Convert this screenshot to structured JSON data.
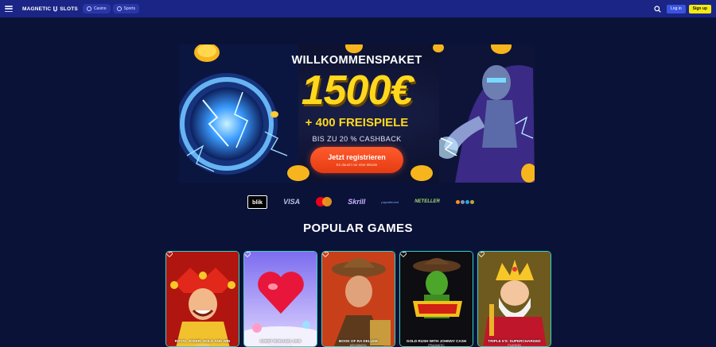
{
  "header": {
    "logo_left": "MAGNETIC",
    "logo_right": "SLOTS",
    "nav": [
      {
        "label": "Casino",
        "icon": "casino-icon"
      },
      {
        "label": "Sports",
        "icon": "sports-icon"
      }
    ],
    "login_label": "Log in",
    "signup_label": "Sign up",
    "colors": {
      "bar": "#1b2585",
      "login": "#3a54e0",
      "signup": "#f3ea13"
    }
  },
  "banner": {
    "title": "WILLKOMMENSPAKET",
    "amount": "1500€",
    "spins": "+ 400 FREISPIELE",
    "cashback": "BIS ZU 20 % CASHBACK",
    "cta_label": "Jetzt registrieren",
    "cta_sub": "Es dauert nur eine Minute",
    "colors": {
      "amount": "#ffd81d",
      "cta": "#ff5b2d"
    }
  },
  "payments": [
    {
      "name": "blik",
      "label": "blik"
    },
    {
      "name": "visa",
      "label": "VISA"
    },
    {
      "name": "mastercard",
      "label": ""
    },
    {
      "name": "skrill",
      "label": "Skrill"
    },
    {
      "name": "paysafecard",
      "label": "paysafecard"
    },
    {
      "name": "neteller",
      "label": "NETELLER"
    },
    {
      "name": "crypto",
      "label": ""
    }
  ],
  "popular": {
    "title": "POPULAR GAMES",
    "games": [
      {
        "title": "ROYAL JOKER: HOLD AND WIN",
        "provider": "PLAYSON"
      },
      {
        "title": "SWEET BONANZA 1000",
        "provider": "PRAGMATIC PLAY"
      },
      {
        "title": "BOOK OF RA DELUXE",
        "provider": "NOVOMATIC"
      },
      {
        "title": "GOLD RUSH WITH JOHNNY CASH",
        "provider": "PRAGMATIC"
      },
      {
        "title": "TRIPLE 5'S: SUPERCHARGED",
        "provider": "PLAYSON"
      }
    ],
    "card_border_color": "#34d6c3"
  }
}
